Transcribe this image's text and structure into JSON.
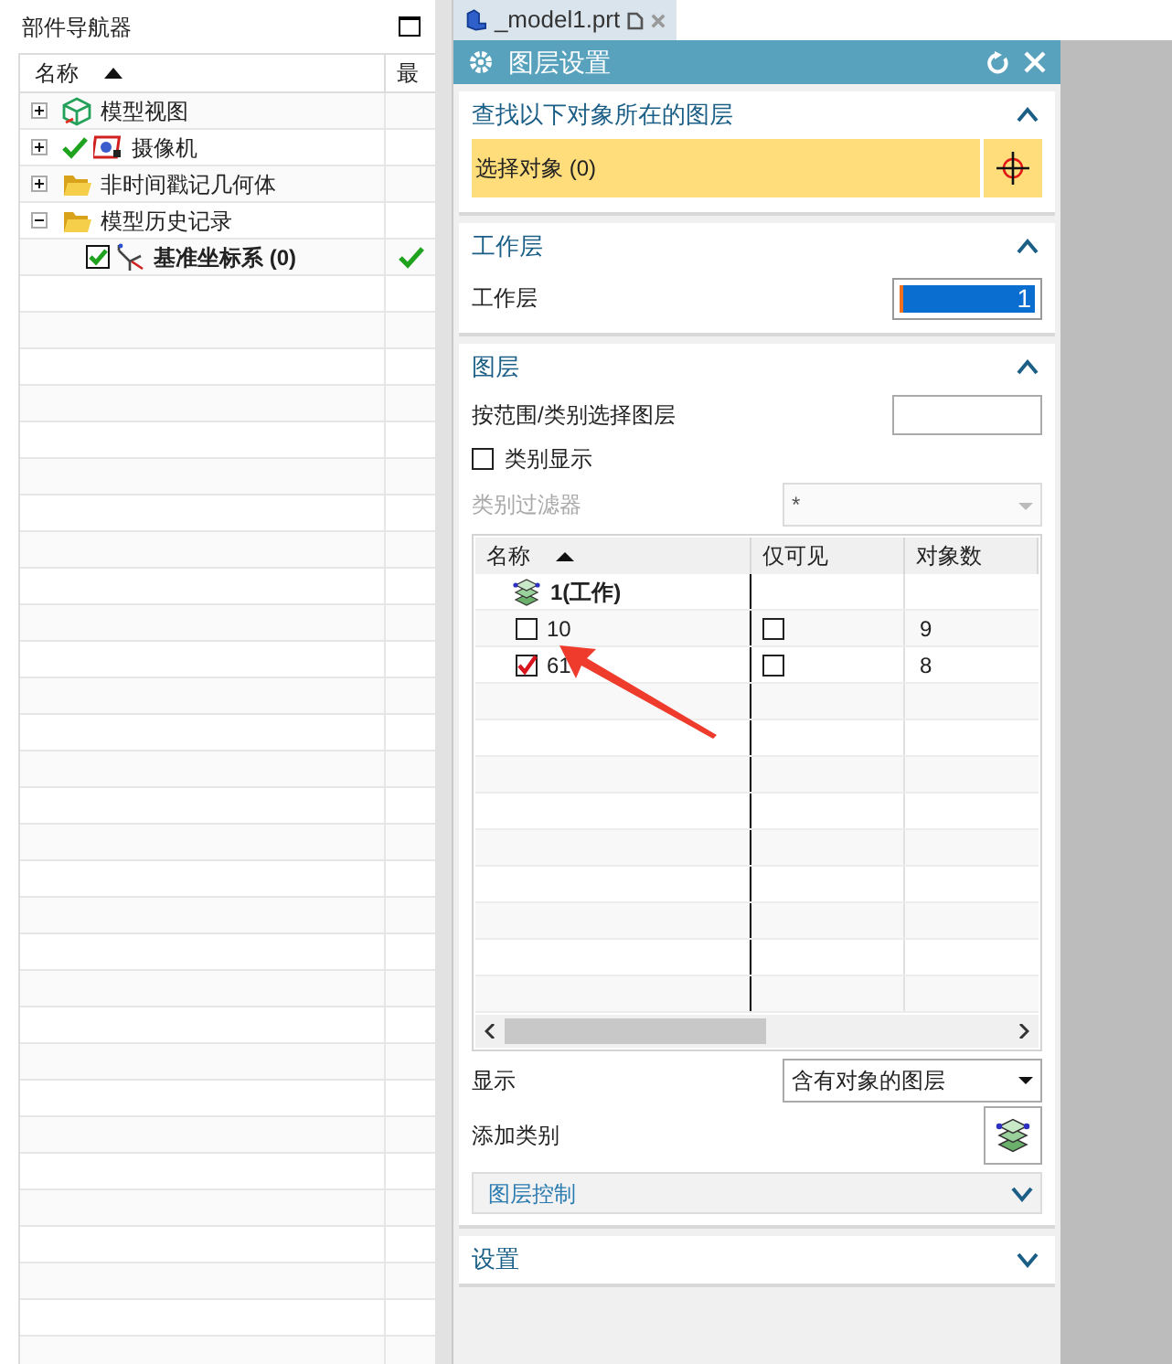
{
  "navigator": {
    "title": "部件导航器",
    "columns": [
      "名称",
      "最"
    ],
    "tree": [
      {
        "label": "模型视图",
        "kind": "model-view",
        "expanded": false,
        "checked": false,
        "latest": false
      },
      {
        "label": "摄像机",
        "kind": "camera",
        "expanded": false,
        "checked": true,
        "latest": false
      },
      {
        "label": "非时间戳记几何体",
        "kind": "folder",
        "expanded": false,
        "checked": false,
        "latest": false
      },
      {
        "label": "模型历史记录",
        "kind": "folder",
        "expanded": true,
        "checked": false,
        "latest": false,
        "children": [
          {
            "label": "基准坐标系 (0)",
            "kind": "datum",
            "checked": true,
            "latest": true
          }
        ]
      }
    ]
  },
  "tab": {
    "title": "_model1.prt"
  },
  "dialog": {
    "title": "图层设置",
    "find_section": {
      "title": "查找以下对象所在的图层",
      "expanded": true,
      "select_label": "选择对象 (0)"
    },
    "work_section": {
      "title": "工作层",
      "expanded": true,
      "label": "工作层",
      "value": "1"
    },
    "layer_section": {
      "title": "图层",
      "expanded": true,
      "range_label": "按范围/类别选择图层",
      "category_display": {
        "label": "类别显示",
        "checked": false
      },
      "filter": {
        "label": "类别过滤器",
        "value": "*",
        "disabled": true
      },
      "table": {
        "columns": [
          "名称",
          "仅可见",
          "对象数"
        ],
        "rows": [
          {
            "kind": "work",
            "name": "1(工作)"
          },
          {
            "kind": "layer",
            "name": "10",
            "checked": false,
            "visible_only": false,
            "count": "9"
          },
          {
            "kind": "layer",
            "name": "61",
            "checked": true,
            "visible_only": false,
            "count": "8"
          }
        ]
      },
      "display": {
        "label": "显示",
        "value": "含有对象的图层"
      },
      "add_category": {
        "label": "添加类别"
      },
      "layer_control": {
        "title": "图层控制",
        "expanded": false
      }
    },
    "settings_section": {
      "title": "设置",
      "expanded": false
    }
  }
}
